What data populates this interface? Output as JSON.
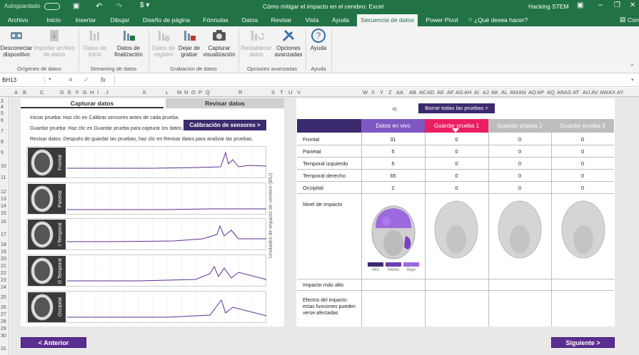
{
  "titlebar": {
    "autosave": "Autoguardado",
    "title": "Cómo mitigar el impacto en el cerebro: Excel",
    "user": "Hacking STEM"
  },
  "tabs": [
    "Archivo",
    "Inicio",
    "Insertar",
    "Dibujar",
    "Diseño de página",
    "Fórmulas",
    "Datos",
    "Revisar",
    "Vista",
    "Ayuda",
    "Secuencia de datos",
    "Power Pivot",
    "¿Qué desea hacer?",
    "Com"
  ],
  "ribbon": {
    "buttons": [
      {
        "label": "Desconectar dispositivo",
        "enabled": true
      },
      {
        "label": "Importar archivo de datos",
        "enabled": false
      },
      {
        "label": "Datos de inicio",
        "enabled": false
      },
      {
        "label": "Datos de finalización",
        "enabled": true
      },
      {
        "label": "Datos de registro",
        "enabled": false
      },
      {
        "label": "Dejar de grabar",
        "enabled": true
      },
      {
        "label": "Capturar visualización",
        "enabled": true
      },
      {
        "label": "Restablecer datos",
        "enabled": false
      },
      {
        "label": "Opciones avanzadas",
        "enabled": true
      },
      {
        "label": "Ayuda",
        "enabled": true
      }
    ],
    "groups": [
      "Orígenes de datos",
      "Streaming de datos",
      "Grabación de datos",
      "Opciones avanzadas",
      "Ayuda"
    ]
  },
  "formula": {
    "cell": "BH13",
    "fx": "fx"
  },
  "columns": [
    "A",
    "B",
    "C",
    "D",
    "E",
    "F",
    "G",
    "H",
    "I",
    "J",
    "K",
    "L",
    "M",
    "N",
    "O",
    "P",
    "Q",
    "R",
    "S",
    "T",
    "U",
    "V",
    "W",
    "X",
    "Y",
    "Z",
    "AA",
    "AB",
    "AC",
    "AD",
    "AE",
    "AF",
    "AG",
    "AH",
    "AI",
    "AJ",
    "AK",
    "AL",
    "AM",
    "AN",
    "AO",
    "AP",
    "AQ",
    "AR",
    "AS",
    "AT",
    "AU",
    "AV",
    "AW",
    "AX",
    "AY"
  ],
  "rows": [
    "3",
    "4",
    "5",
    "6",
    "7",
    "8",
    "9",
    "10",
    "11",
    "12",
    "13",
    "14",
    "15",
    "16",
    "17",
    "18",
    "19",
    "20",
    "21",
    "22",
    "23",
    "24",
    "25",
    "26",
    "27",
    "28",
    "29",
    "30",
    "31"
  ],
  "left": {
    "tab_capture": "Capturar datos",
    "tab_review": "Revisar datos",
    "instr1": "Iniciar prueba: Haz clic en Calibrar sensores antes de cada prueba.",
    "instr2": "Guardar prueba: Haz clic en Guardar prueba para capturar los datos.",
    "instr3": "Revisar datos: Después de guardar las pruebas, haz clic en Revisar datos para analizar las pruebas.",
    "calibrate": "Calibración de sensores >",
    "yaxis": "Unidades de impacto de cerebro (BIU)",
    "charts": [
      "Frontal",
      "Parietal",
      "I Temporal",
      "D Temporal",
      "Occipital"
    ]
  },
  "right": {
    "clear_all": "Borrar todas las pruebas >",
    "headers": [
      "Datos en vivo",
      "Guardar prueba 1",
      "Guardar prueba 2",
      "Guardar prueba 3"
    ],
    "rows": [
      {
        "name": "Frontal",
        "live": "31",
        "t1": "0",
        "t2": "0",
        "t3": "0"
      },
      {
        "name": "Parietal",
        "live": "5",
        "t1": "0",
        "t2": "0",
        "t3": "0"
      },
      {
        "name": "Temporal izquierdo",
        "live": "5",
        "t1": "0",
        "t2": "0",
        "t3": "0"
      },
      {
        "name": "Temporal derecho",
        "live": "65",
        "t1": "0",
        "t2": "0",
        "t3": "0"
      },
      {
        "name": "Occipital",
        "live": "2",
        "t1": "0",
        "t2": "0",
        "t3": "0"
      }
    ],
    "impact_level": "Nivel de impacto",
    "legend": [
      "Alto",
      "Medio",
      "Bajo"
    ],
    "highest": "Impacto más alto",
    "effects": "Efectos del impacto: estas funciones pueden verse afectadas"
  },
  "nav": {
    "prev": "< Anterior",
    "next": "Siguiente >"
  },
  "colors": {
    "excel_green": "#217346",
    "purple": "#5c2d91",
    "dark_purple": "#3c2a6e",
    "live_header": "#7e57c2",
    "pink": "#e91e63"
  }
}
